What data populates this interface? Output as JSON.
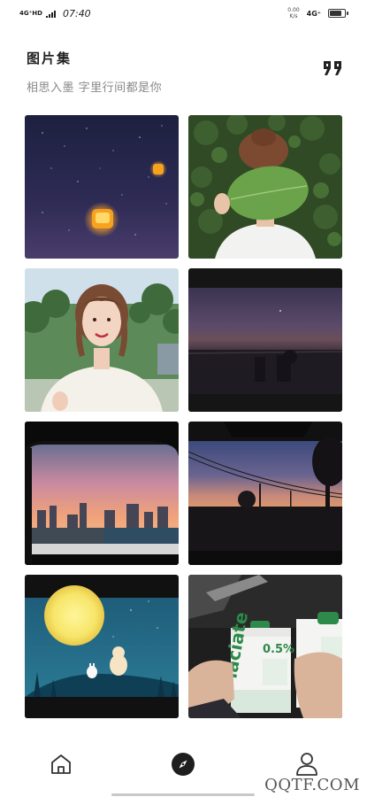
{
  "status_bar": {
    "network_left": "4G⁺HD",
    "time": "07:40",
    "speed_top": "0.00",
    "speed_bottom": "K/s",
    "network_right": "4G⁺",
    "battery_level": 0.85
  },
  "header": {
    "title": "图片集",
    "subtitle": "相思入墨 字里行间都是你",
    "quote_icon": "quote-icon"
  },
  "gallery": {
    "items": [
      {
        "name": "gallery-photo-sky-lanterns",
        "icon": "image"
      },
      {
        "name": "gallery-photo-leaf-face",
        "icon": "image"
      },
      {
        "name": "gallery-photo-smiling-girl",
        "icon": "image"
      },
      {
        "name": "gallery-photo-dusk-rooftops",
        "icon": "image"
      },
      {
        "name": "gallery-photo-city-sunset-car",
        "icon": "image"
      },
      {
        "name": "gallery-photo-power-lines-dusk",
        "icon": "image"
      },
      {
        "name": "gallery-photo-moon-illustration",
        "icon": "image"
      },
      {
        "name": "gallery-photo-milk-cartons",
        "icon": "image"
      }
    ],
    "milk_label": "0.5%"
  },
  "bottom_nav": {
    "items": [
      {
        "name": "home",
        "icon": "home-icon"
      },
      {
        "name": "discover",
        "icon": "compass-icon"
      },
      {
        "name": "profile",
        "icon": "user-icon"
      }
    ],
    "active": "discover"
  },
  "watermark": "QQTF.COM",
  "colors": {
    "accent": "#222222",
    "subtitle": "#888888"
  }
}
